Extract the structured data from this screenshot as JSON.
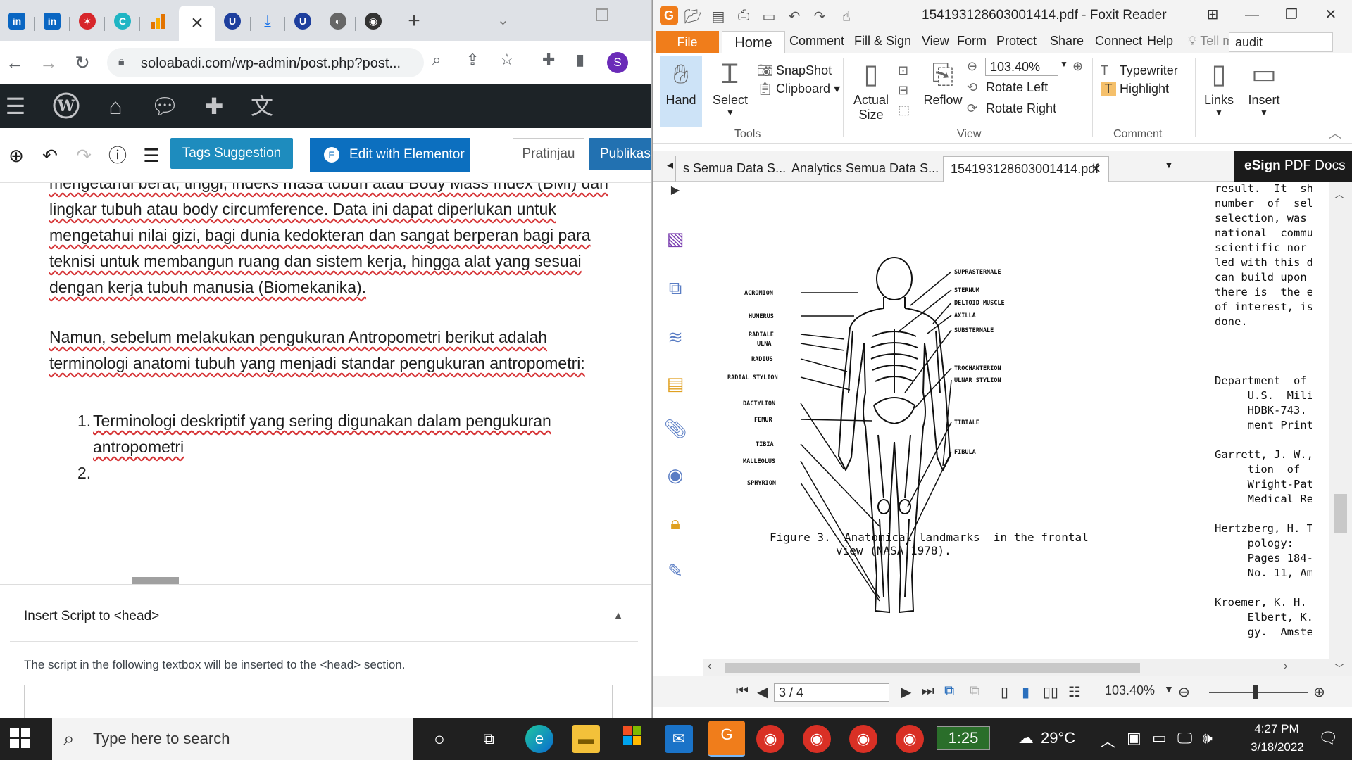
{
  "chrome": {
    "active_tab_close": "×",
    "new_tab": "+",
    "url": "soloabadi.com/wp-admin/post.php?post...",
    "profile_letter": "S"
  },
  "editor": {
    "tags_button": "Tags Suggestion",
    "elementor_button": "Edit with Elementor",
    "preview_button": "Pratinjau",
    "publish_button": "Publikasik",
    "para1_lines": [
      "mengetahui berat, tinggi, indeks masa tubuh atau Body Mass Index (BMI) dan",
      "lingkar tubuh atau body circumference. Data ini dapat diperlukan untuk",
      "mengetahui nilai gizi, bagi dunia kedokteran dan sangat berperan bagi para",
      "teknisi untuk membangun ruang dan sistem kerja, hingga alat yang sesuai",
      "dengan kerja tubuh manusia (Biomekanika)."
    ],
    "para2_lines": [
      "Namun, sebelum melakukan pengukuran Antropometri berikut adalah",
      "terminologi anatomi tubuh yang menjadi standar pengukuran antropometri:"
    ],
    "list_item1_line1": "Terminologi deskriptif yang sering digunakan dalam pengukuran",
    "list_item1_line2": "antropometri",
    "list_num1": "1.",
    "list_num2": "2.",
    "metabox_title": "Insert Script to <head>",
    "metabox_desc": "The script in the following textbox will be inserted to the <head> section."
  },
  "foxit": {
    "title": "154193128603001414.pdf - Foxit Reader",
    "menu": [
      "File",
      "Home",
      "Comment",
      "Fill & Sign",
      "View",
      "Form",
      "Protect",
      "Share",
      "Connect",
      "Help"
    ],
    "tell_me": "Tell me...",
    "search_value": "audit",
    "ribbon": {
      "hand": "Hand",
      "select": "Select",
      "snapshot": "SnapShot",
      "clipboard": "Clipboard",
      "actual_size_1": "Actual",
      "actual_size_2": "Size",
      "reflow": "Reflow",
      "zoom": "103.40%",
      "rotate_left": "Rotate Left",
      "rotate_right": "Rotate Right",
      "typewriter": "Typewriter",
      "highlight": "Highlight",
      "links": "Links",
      "insert": "Insert",
      "group_tools": "Tools",
      "group_view": "View",
      "group_comment": "Comment"
    },
    "doc_tabs": [
      "s Semua Data S...",
      "Analytics Semua Data S...",
      "154193128603001414.pdf"
    ],
    "esign_label_bold": "eSign",
    "esign_label": " PDF Docs",
    "figure_labels_left": [
      "ACROMION",
      "HUMERUS",
      "RADIALE",
      "ULNA",
      "RADIUS",
      "RADIAL STYLION",
      "DACTYLION",
      "FEMUR",
      "TIBIA",
      "MALLEOLUS",
      "SPHYRION"
    ],
    "figure_labels_right": [
      "SUPRASTERNALE",
      "STERNUM",
      "DELTOID MUSCLE",
      "AXILLA",
      "SUBSTERNALE",
      "TROCHANTERION",
      "ULNAR STYLION",
      "TIBIALE",
      "FIBULA"
    ],
    "figure_caption_1": "Figure 3.  Anatomical landmarks  in the frontal",
    "figure_caption_2": "view (NASA 1978).",
    "right_column_text": "result.  It  shows  t\nnumber  of  selected \nselection, was  not ac\nnational  community. \nscientific nor the app\nled with this draft.  \ncan build upon the exp\nthere is  the evidence\nof interest, is contro\ndone.\n\n                  REFE\n\nDepartment  of Defense\n     U.S.  Military Pe\n     HDBK-743.  Washin\n     ment Printing Off\n\nGarrett, J. W., Kenned\n     tion  of   Anthro\n     Wright-Patterson \n     Medical Research \n\nHertzberg, H. T. E., l\n     pology:   Past, \n     Pages 184-204 in \n     No. 11, Am. Anthr\n\nKroemer, K. H. E., Kro\n     Elbert, K. E., 19\n     gy.  Amsterdam:",
    "page_indicator": "3 / 4",
    "status_zoom": "103.40%"
  },
  "taskbar": {
    "search_placeholder": "Type here to search",
    "clock_widget": "1:25",
    "weather": "29°C",
    "time": "4:27 PM",
    "date": "3/18/2022"
  }
}
